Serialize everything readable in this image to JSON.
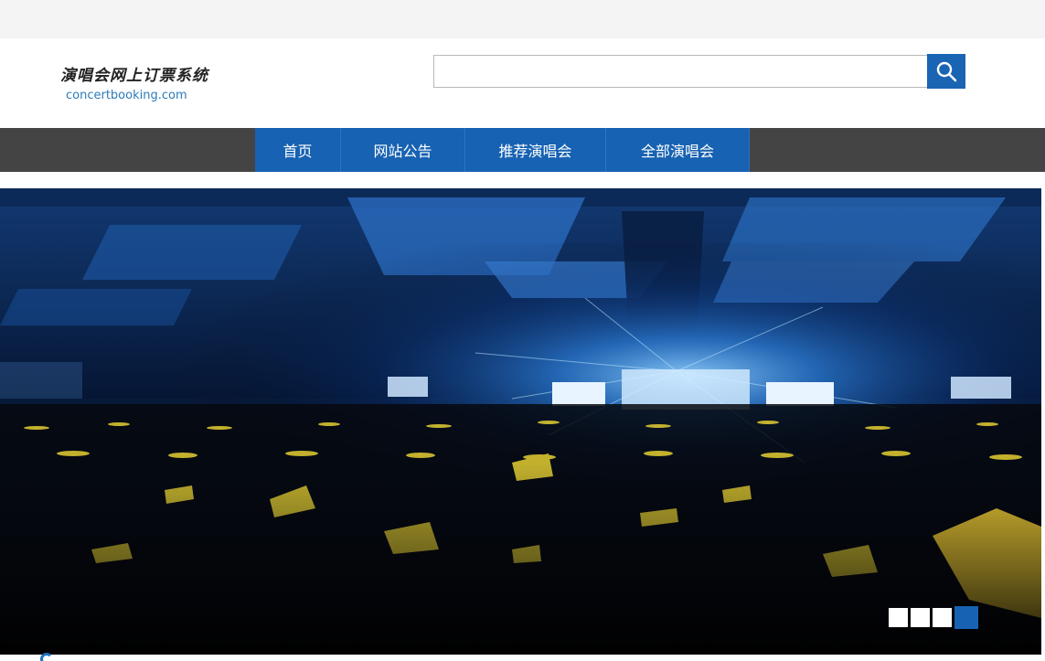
{
  "header": {
    "logo_cn": "演唱会网上订票系统",
    "logo_url": "concertbooking.com"
  },
  "search": {
    "placeholder": "",
    "value": "",
    "button_icon": "search-icon"
  },
  "nav": {
    "items": [
      {
        "label": "首页"
      },
      {
        "label": "网站公告"
      },
      {
        "label": "推荐演唱会"
      },
      {
        "label": "全部演唱会"
      }
    ]
  },
  "banner": {
    "image": "concert-crowd-photo",
    "slides_total": 4,
    "active_slide": 4
  },
  "colors": {
    "accent": "#1762b2",
    "nav_bg": "#444444",
    "topbar_bg": "#f4f4f4"
  }
}
